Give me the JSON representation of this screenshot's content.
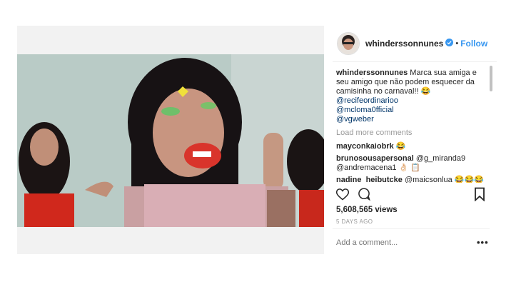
{
  "post": {
    "username": "whinderssonnunes",
    "follow_label": "Follow",
    "separator": "•",
    "caption_user": "whinderssonnunes",
    "caption_text": " Marca sua amiga e seu amigo que não podem esquecer da camisinha no carnaval!! 😂",
    "mentions": [
      "@recifeordinarioo",
      "@mcloma0fficial",
      "@vgweber"
    ],
    "load_more_label": "Load more comments",
    "comments": [
      {
        "user": "mayconkaiobrk",
        "text": " 😂"
      },
      {
        "user": "brunosousapersonal",
        "text": " @g_miranda9 @andremacena1 👌🏻 📋"
      },
      {
        "user": "nadine_heibutcke",
        "text": " @maicsonlua 😂😂😂"
      }
    ],
    "views": "5,608,565 views",
    "time_ago": "5 DAYS AGO",
    "add_comment_placeholder": "Add a comment...",
    "more_label": "•••"
  },
  "icons": {
    "like": "heart-icon",
    "comment": "comment-bubble-icon",
    "save": "bookmark-icon",
    "verified": "verified-badge-icon"
  },
  "colors": {
    "accent": "#3897f0",
    "verified": "#3897f0",
    "text": "#262626",
    "muted": "#999999"
  }
}
